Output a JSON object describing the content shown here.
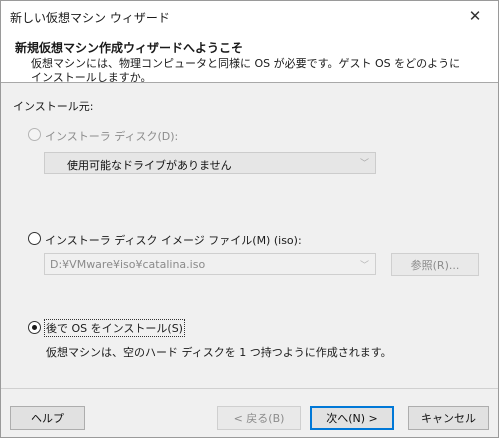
{
  "window": {
    "title": "新しい仮想マシン ウィザード",
    "close_glyph": "✕"
  },
  "header": {
    "title": "新規仮想マシン作成ウィザードへようこそ",
    "description": "仮想マシンには、物理コンピュータと同様に OS が必要です。ゲスト OS をどのようにインストールしますか。"
  },
  "install_source_label": "インストール元:",
  "option_disc": {
    "label": "インストーラ ディスク(D):",
    "combo_value": "使用可能なドライブがありません",
    "enabled": false,
    "selected": false
  },
  "option_iso": {
    "label": "インストーラ ディスク イメージ ファイル(M) (iso):",
    "path": "D:¥VMware¥iso¥catalina.iso",
    "browse_label": "参照(R)...",
    "enabled": true,
    "selected": false
  },
  "option_later": {
    "label": "後で OS をインストール(S)",
    "description": "仮想マシンは、空のハード ディスクを 1 つ持つように作成されます。",
    "selected": true
  },
  "footer": {
    "help": "ヘルプ",
    "back": "< 戻る(B)",
    "next": "次へ(N) >",
    "cancel": "キャンセル"
  },
  "icons": {
    "dropdown": "chevron-down-icon",
    "close": "close-icon"
  }
}
